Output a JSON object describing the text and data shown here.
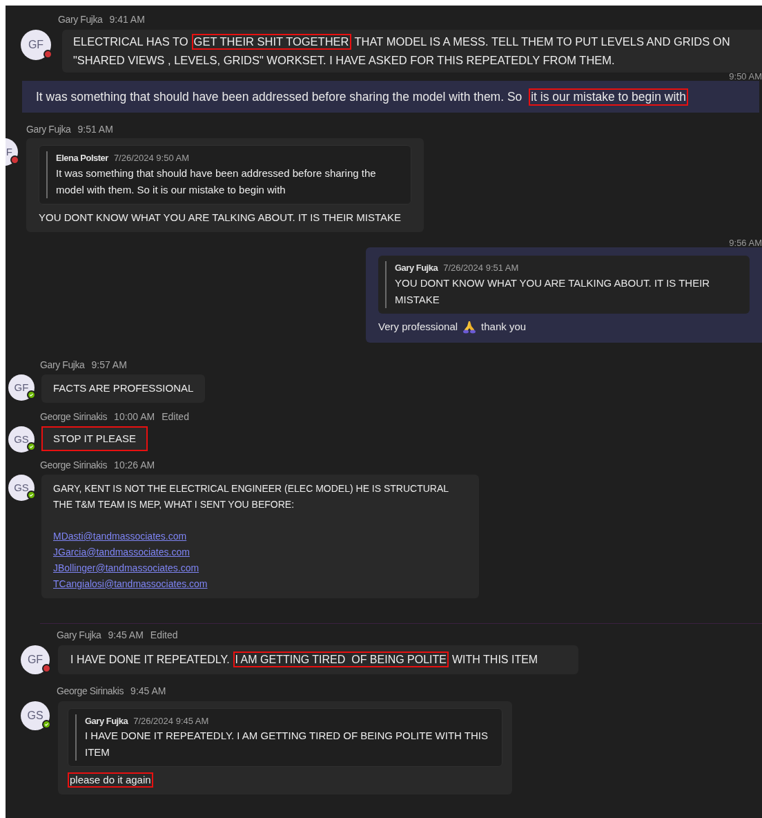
{
  "messages": [
    {
      "kind": "incoming",
      "author": "Gary Fujka",
      "time": "9:41 AM",
      "initials": "GF",
      "available": false,
      "body": [
        {
          "kind": "text",
          "segments": [
            {
              "kind": "text",
              "text": "ELECTRICAL HAS TO",
              "highlighted": false
            },
            {
              "kind": "text",
              "text": "GET THEIR SHIT TOGETHER",
              "highlighted": true
            },
            {
              "kind": "text",
              "text": "THAT MODEL IS A MESS. TELL THEM TO PUT LEVELS AND GRIDS ON",
              "highlighted": false
            }
          ]
        },
        {
          "kind": "text",
          "segments": [
            {
              "kind": "text",
              "text": "\"SHARED VIEWS , LEVELS, GRIDS\" WORKSET. I HAVE ASKED FOR THIS REPEATEDLY FROM THEM.",
              "highlighted": false
            }
          ]
        }
      ]
    },
    {
      "kind": "outgoing",
      "time": "9:50 AM",
      "body": [
        {
          "kind": "text",
          "segments": [
            {
              "kind": "text",
              "text": "It was something that should have been addressed before sharing the model with them. So ",
              "highlighted": false
            },
            {
              "kind": "text",
              "text": "it is our mistake to begin with",
              "highlighted": true
            }
          ]
        }
      ]
    },
    {
      "kind": "incoming",
      "author": "Gary Fujka",
      "time": "9:51 AM",
      "initials": "F",
      "available": false,
      "quote": {
        "author": "Elena Polster",
        "time": "7/26/2024 9:50 AM",
        "text": "It was something that should have been addressed before sharing the model with them. So it is our mistake to begin with"
      },
      "body": [
        {
          "kind": "text",
          "segments": [
            {
              "kind": "text",
              "text": "YOU DONT KNOW WHAT YOU ARE TALKING ABOUT. IT IS THEIR MISTAKE",
              "highlighted": false
            }
          ]
        }
      ]
    },
    {
      "kind": "outgoing",
      "time": "9:56 AM",
      "quote": {
        "author": "Gary Fujka",
        "time": "7/26/2024 9:51 AM",
        "text": "YOU DONT KNOW WHAT YOU ARE TALKING ABOUT. IT IS THEIR MISTAKE"
      },
      "body": [
        {
          "kind": "text",
          "segments": [
            {
              "kind": "text",
              "text": "Very professional",
              "highlighted": false
            },
            {
              "kind": "emoji"
            },
            {
              "kind": "text",
              "text": "thank you",
              "highlighted": false
            }
          ]
        }
      ]
    },
    {
      "kind": "incoming",
      "author": "Gary Fujka",
      "time": "9:57 AM",
      "initials": "GF",
      "available": true,
      "body": [
        {
          "kind": "text",
          "segments": [
            {
              "kind": "text",
              "text": "FACTS ARE PROFESSIONAL",
              "highlighted": false
            }
          ]
        }
      ]
    },
    {
      "kind": "incoming",
      "author": "George Sirinakis",
      "time": "10:00 AM",
      "edited_label": "Edited",
      "initials": "GS",
      "available": true,
      "highlighted": true,
      "body": [
        {
          "kind": "text",
          "segments": [
            {
              "kind": "text",
              "text": "STOP IT PLEASE",
              "highlighted": false
            }
          ]
        }
      ]
    },
    {
      "kind": "incoming",
      "author": "George Sirinakis",
      "time": "10:26 AM",
      "initials": "GS",
      "available": true,
      "body": [
        {
          "kind": "text",
          "segments": [
            {
              "kind": "text",
              "text": "GARY, KENT IS NOT THE ELECTRICAL ENGINEER (ELEC MODEL) HE IS STRUCTURAL",
              "highlighted": false
            }
          ]
        },
        {
          "kind": "text",
          "segments": [
            {
              "kind": "text",
              "text": "THE T&M TEAM IS MEP, WHAT I SENT YOU BEFORE:",
              "highlighted": false
            }
          ]
        },
        {
          "kind": "gap"
        },
        {
          "kind": "link",
          "text": "MDasti@tandmassociates.com"
        },
        {
          "kind": "link",
          "text": "JGarcia@tandmassociates.com"
        },
        {
          "kind": "link",
          "text": "JBollinger@tandmassociates.com"
        },
        {
          "kind": "link",
          "text": "TCangialosi@tandmassociates.com"
        }
      ]
    },
    {
      "kind": "divider"
    },
    {
      "kind": "incoming",
      "author": "Gary Fujka",
      "time": "9:45 AM",
      "edited_label": "Edited",
      "initials": "GF",
      "available": false,
      "body": [
        {
          "kind": "text",
          "segments": [
            {
              "kind": "text",
              "text": "I HAVE DONE IT REPEATEDLY.",
              "highlighted": false
            },
            {
              "kind": "text",
              "text": "I AM GETTING TIRED  OF BEING POLITE",
              "highlighted": true
            },
            {
              "kind": "text",
              "text": "WITH THIS ITEM",
              "highlighted": false
            }
          ]
        }
      ]
    },
    {
      "kind": "incoming",
      "author": "George Sirinakis",
      "time": "9:45 AM",
      "initials": "GS",
      "available": true,
      "quote": {
        "author": "Gary Fujka",
        "time": "7/26/2024 9:45 AM",
        "text": "I HAVE DONE IT REPEATEDLY. I AM GETTING TIRED OF BEING POLITE WITH THIS ITEM"
      },
      "body": [
        {
          "kind": "text",
          "segments": [
            {
              "kind": "text",
              "text": "please do it again",
              "highlighted": true
            }
          ]
        }
      ]
    }
  ]
}
